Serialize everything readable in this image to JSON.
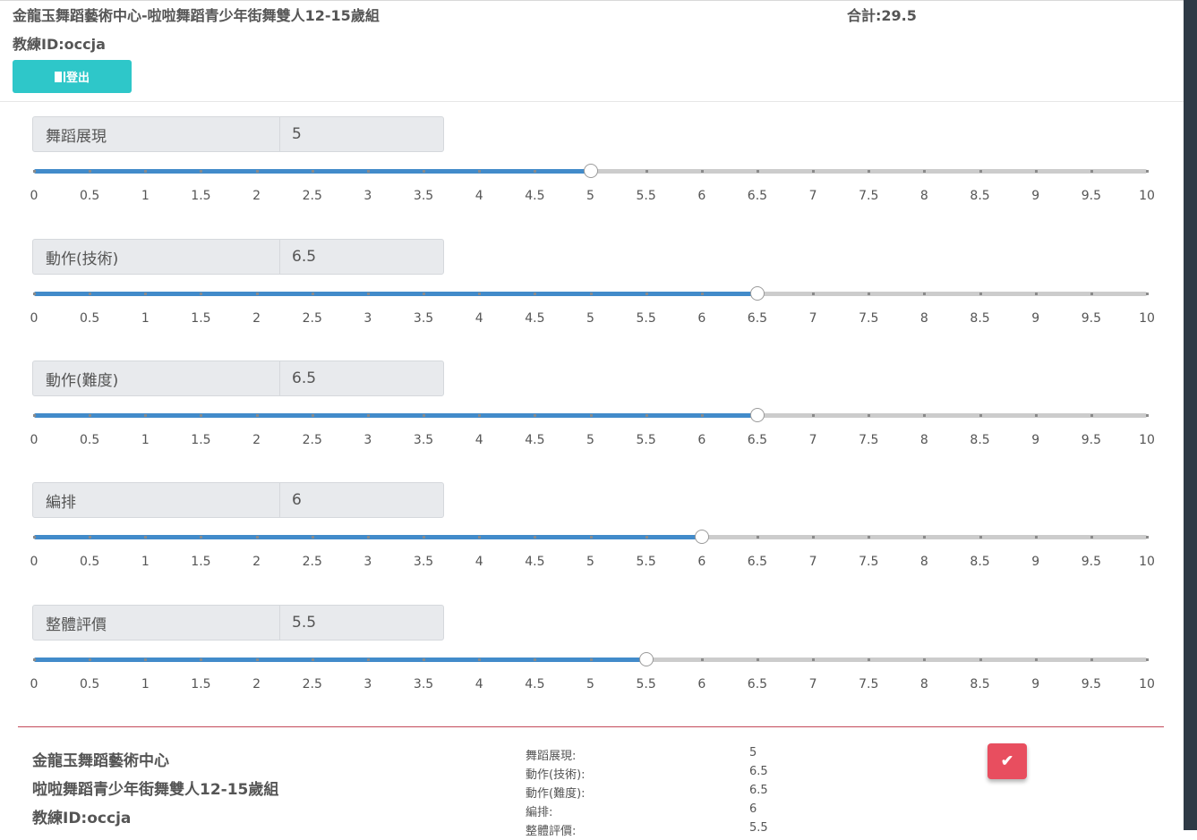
{
  "header": {
    "title": "金龍玉舞蹈藝術中心-啦啦舞蹈青少年街舞雙人12-15歲組",
    "total_label": "合計:29.5",
    "coach": "教練ID:occja",
    "logout_label": "登出",
    "logout_icon": "door-icon"
  },
  "slider": {
    "min": 0,
    "max": 10,
    "step": 0.5,
    "tick_labels": [
      "0",
      "0.5",
      "1",
      "1.5",
      "2",
      "2.5",
      "3",
      "3.5",
      "4",
      "4.5",
      "5",
      "5.5",
      "6",
      "6.5",
      "7",
      "7.5",
      "8",
      "8.5",
      "9",
      "9.5",
      "10"
    ]
  },
  "criteria": [
    {
      "label": "舞蹈展現",
      "value": "5"
    },
    {
      "label": "動作(技術)",
      "value": "6.5"
    },
    {
      "label": "動作(難度)",
      "value": "6.5"
    },
    {
      "label": "編排",
      "value": "6"
    },
    {
      "label": "整體評價",
      "value": "5.5"
    }
  ],
  "summary": {
    "studio": "金龍玉舞蹈藝術中心",
    "category": "啦啦舞蹈青少年街舞雙人12-15歲組",
    "coach": "教練ID:occja",
    "rows": [
      {
        "label": "舞蹈展現:",
        "value": "5"
      },
      {
        "label": "動作(技術):",
        "value": "6.5"
      },
      {
        "label": "動作(難度):",
        "value": "6.5"
      },
      {
        "label": "編排:",
        "value": "6"
      },
      {
        "label": "整體評價:",
        "value": "5.5"
      }
    ],
    "confirm_icon": "check-icon"
  },
  "colors": {
    "accent": "#2ec7c9",
    "slider_fill": "#428bca",
    "confirm": "#e84e5f"
  }
}
